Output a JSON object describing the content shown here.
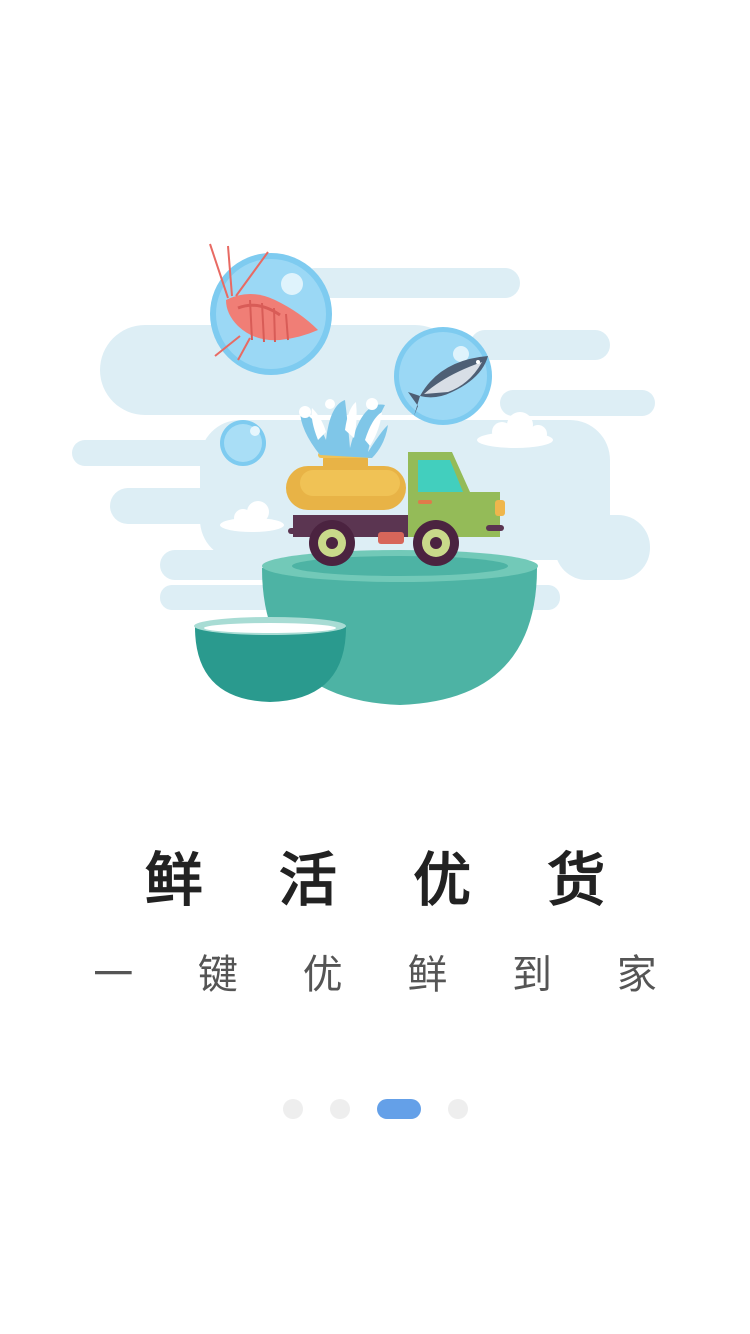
{
  "onboarding": {
    "title": "鲜 活 优 货",
    "subtitle": "一 键 优 鲜 到 家"
  },
  "pager": {
    "total": 4,
    "active_index": 2,
    "active_color": "#64A0E8",
    "inactive_color": "#EEEEEE"
  },
  "illustration": {
    "icons": [
      "shrimp-icon",
      "fish-icon",
      "water-bubble-icon",
      "truck-icon",
      "water-splash-icon",
      "bowl-icon",
      "cloud-icon"
    ]
  }
}
